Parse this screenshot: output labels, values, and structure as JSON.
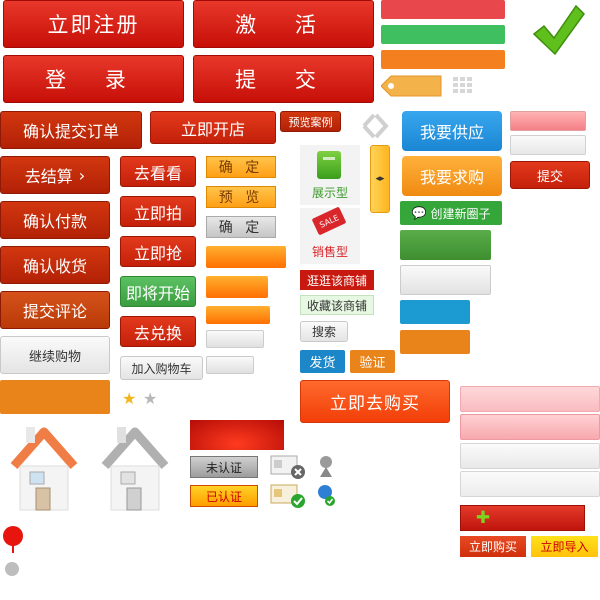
{
  "buttons": {
    "register_now": "立即注册",
    "activate": "激 活",
    "login": "登 录",
    "submit_big": "提 交",
    "confirm_order": "确认提交订单",
    "open_shop": "立即开店",
    "preview_case": "预览案例",
    "checkout": "去结算",
    "look": "去看看",
    "shoot_now": "立即拍",
    "grab_now": "立即抢",
    "start_soon": "即将开始",
    "redeem": "去兑换",
    "add_cart": "加入购物车",
    "confirm_pay": "确认付款",
    "confirm_receipt": "确认收货",
    "submit_review": "提交评论",
    "continue_shopping": "继续购物",
    "confirm1": "确 定",
    "preview": "预 览",
    "confirm2": "确 定",
    "display_type": "展示型",
    "sales_type": "销售型",
    "sale_tag": "SALE",
    "visit_shop": "逛逛该商铺",
    "fav_shop": "收藏该商铺",
    "search": "搜索",
    "ship": "发货",
    "verify": "验证",
    "buy_now_big": "立即去购买",
    "supply": "我要供应",
    "purchase": "我要求购",
    "submit_small": "提交",
    "create_circle": "创建新圈子",
    "unverified": "未认证",
    "verified": "已认证",
    "buy_now_small": "立即购买",
    "import_now": "立即导入",
    "plus": "✚",
    "checkmark": "✔"
  },
  "colors": {
    "red_bar": "#e8474b",
    "green_bar": "#3fbf60",
    "orange_bar": "#f47f1e",
    "blue_btn": "#1f8fd8",
    "orange_btn": "#f5961b",
    "green_btn": "#3aa13f",
    "teal_bar": "#1b9bd1",
    "orange_bar2": "#e9841b"
  }
}
